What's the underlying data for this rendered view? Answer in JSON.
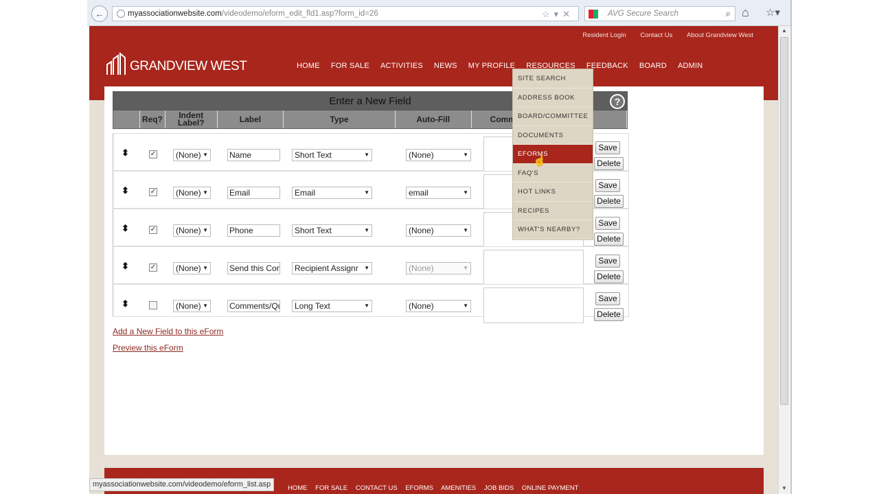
{
  "browser": {
    "url_domain": "myassociationwebsite.com",
    "url_path": "/videodemo/eform_edit_fld1.asp?form_id=26",
    "search_placeholder": "AVG Secure Search"
  },
  "utility_nav": [
    "Resident Login",
    "Contact Us",
    "About Grandview West"
  ],
  "logo_text": "GRANDVIEW WEST",
  "main_nav": [
    "HOME",
    "FOR SALE",
    "ACTIVITIES",
    "NEWS",
    "MY PROFILE",
    "RESOURCES",
    "FEEDBACK",
    "BOARD",
    "ADMIN"
  ],
  "resources_menu": [
    "SITE SEARCH",
    "ADDRESS BOOK",
    "BOARD/COMMITTEE",
    "DOCUMENTS",
    "EFORMS",
    "FAQ'S",
    "HOT LINKS",
    "RECIPES",
    "WHAT'S NEARBY?"
  ],
  "table": {
    "title": "Enter a New Field",
    "headers": [
      "",
      "Req?",
      "Indent Label?",
      "Label",
      "Type",
      "Auto-Fill",
      "Comm"
    ],
    "rows": [
      {
        "required": true,
        "indent": "(None)",
        "label": "Name",
        "type": "Short Text",
        "autofill": "(None)"
      },
      {
        "required": true,
        "indent": "(None)",
        "label": "Email",
        "type": "Email",
        "autofill": "email"
      },
      {
        "required": true,
        "indent": "(None)",
        "label": "Phone",
        "type": "Short Text",
        "autofill": "(None)"
      },
      {
        "required": true,
        "indent": "(None)",
        "label": "Send this Con",
        "type": "Recipient Assignr",
        "autofill": "(None)"
      },
      {
        "required": false,
        "indent": "(None)",
        "label": "Comments/Qu",
        "type": "Long Text",
        "autofill": "(None)"
      }
    ],
    "save_label": "Save",
    "delete_label": "Delete"
  },
  "links": {
    "add_field": "Add a New Field to this eForm",
    "preview": "Preview this eForm"
  },
  "footer_nav": [
    "HOME",
    "FOR SALE",
    "CONTACT US",
    "EFORMS",
    "AMENITIES",
    "JOB BIDS",
    "ONLINE PAYMENT"
  ],
  "status_url": "myassociationwebsite.com/videodemo/eform_list.asp"
}
